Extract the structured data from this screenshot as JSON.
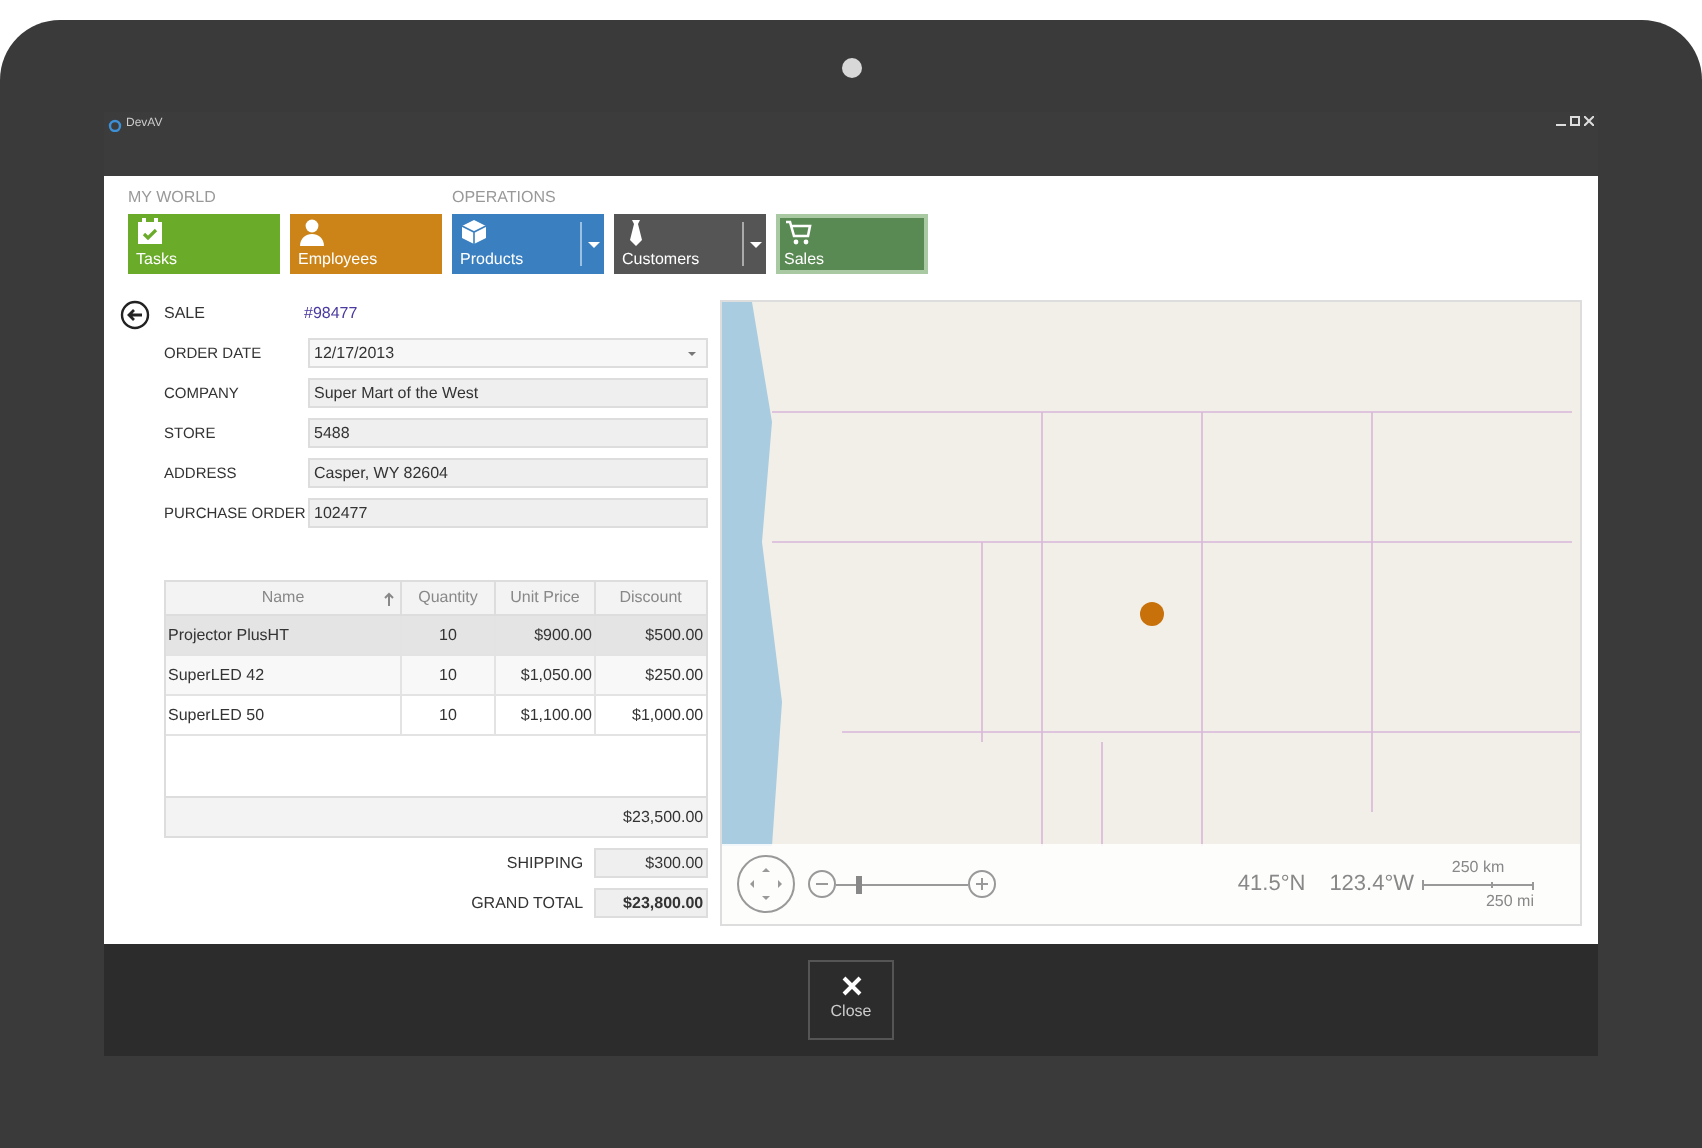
{
  "window": {
    "title": "DevAV"
  },
  "tile_groups": [
    {
      "label": "MY WORLD",
      "tiles": [
        {
          "label": "Tasks",
          "kind": "calendar",
          "color": "#6aac2a",
          "dropdown": false,
          "selected": false
        },
        {
          "label": "Employees",
          "kind": "person",
          "color": "#cc8418",
          "dropdown": false,
          "selected": false
        }
      ]
    },
    {
      "label": "OPERATIONS",
      "tiles": [
        {
          "label": "Products",
          "kind": "box",
          "color": "#3a7fc0",
          "dropdown": true,
          "selected": false
        },
        {
          "label": "Customers",
          "kind": "tie",
          "color": "#555555",
          "dropdown": true,
          "selected": false
        },
        {
          "label": "Sales",
          "kind": "cart",
          "color": "#5a8a53",
          "dropdown": false,
          "selected": true
        }
      ]
    }
  ],
  "form": {
    "sale_label": "SALE",
    "sale_number": "#98477",
    "fields": [
      {
        "label": "ORDER DATE",
        "value": "12/17/2013",
        "kind": "date"
      },
      {
        "label": "COMPANY",
        "value": "Super Mart of the West",
        "kind": "text"
      },
      {
        "label": "STORE",
        "value": "5488",
        "kind": "text"
      },
      {
        "label": "ADDRESS",
        "value": "Casper, WY 82604",
        "kind": "text"
      },
      {
        "label": "PURCHASE ORDER",
        "value": "102477",
        "kind": "text"
      }
    ]
  },
  "table": {
    "columns": [
      "Name",
      "Quantity",
      "Unit Price",
      "Discount"
    ],
    "rows": [
      {
        "cells": [
          "Projector PlusHT",
          "10",
          "$900.00",
          "$500.00"
        ],
        "selected": true
      },
      {
        "cells": [
          "SuperLED 42",
          "10",
          "$1,050.00",
          "$250.00"
        ],
        "selected": false
      },
      {
        "cells": [
          "SuperLED 50",
          "10",
          "$1,100.00",
          "$1,000.00"
        ],
        "selected": false
      }
    ],
    "total": "$23,500.00"
  },
  "summary": [
    {
      "label": "SHIPPING",
      "value": "$300.00",
      "bold": false
    },
    {
      "label": "GRAND TOTAL",
      "value": "$23,800.00",
      "bold": true
    }
  ],
  "map": {
    "zoom": {
      "level": 0.18
    },
    "latitude": "41.5°N",
    "longitude": "123.4°W",
    "scale_km": "250 km",
    "scale_mi": "250 mi"
  },
  "footer": {
    "close_label": "Close"
  }
}
